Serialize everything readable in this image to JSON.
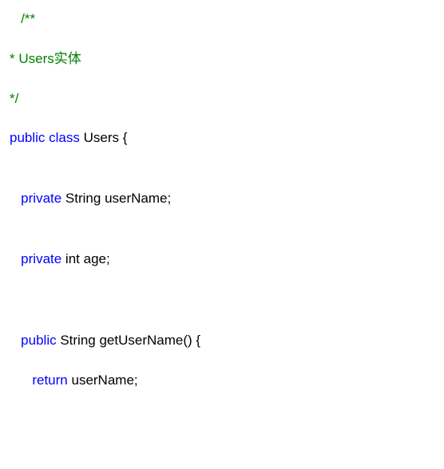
{
  "code": {
    "indent1": "   ",
    "indent2": "      ",
    "indent3": "         ",
    "javadoc_open": "/**",
    "javadoc_line1_prefix": "* ",
    "javadoc_line1_text": "Users实体",
    "javadoc_close": "*/",
    "class_decl": {
      "modifier": "public class",
      "name": " Users {",
      "full_suffix": " Users {"
    },
    "field1": {
      "modifier": "private",
      "type": " String ",
      "name": "userName;"
    },
    "field2": {
      "modifier": "private",
      "type": " int ",
      "name": "age;"
    },
    "method1": {
      "modifier": "public",
      "type": " String ",
      "signature": "getUserName() {"
    },
    "return1": {
      "keyword": "return",
      "value": " userName;"
    }
  }
}
